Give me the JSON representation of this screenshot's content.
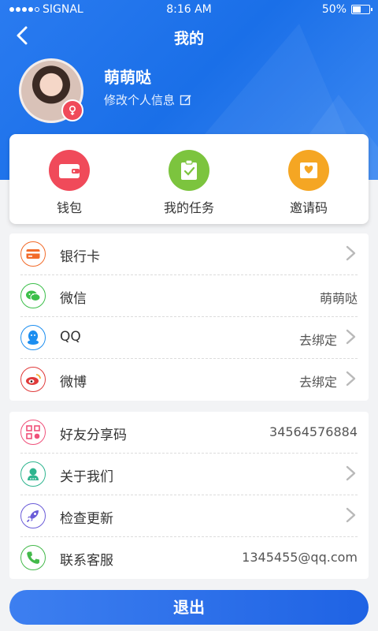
{
  "status_bar": {
    "carrier": "SIGNAL",
    "time": "8:16 AM",
    "battery": "50%",
    "battery_level": 0.5
  },
  "nav": {
    "title": "我的"
  },
  "profile": {
    "name": "萌萌哒",
    "edit_label": "修改个人信息"
  },
  "quick_actions": [
    {
      "label": "钱包",
      "icon": "wallet-icon",
      "color": "#f04a5a"
    },
    {
      "label": "我的任务",
      "icon": "task-icon",
      "color": "#7cc43e"
    },
    {
      "label": "邀请码",
      "icon": "invite-icon",
      "color": "#f5a623"
    }
  ],
  "account_rows": [
    {
      "label": "银行卡",
      "value": "",
      "icon": "bank-card-icon",
      "color": "#f26b2a",
      "arrow": true
    },
    {
      "label": "微信",
      "value": "萌萌哒",
      "icon": "wechat-icon",
      "color": "#3cbf4a",
      "arrow": false
    },
    {
      "label": "QQ",
      "value": "去绑定",
      "icon": "qq-icon",
      "color": "#1c8ef0",
      "arrow": true
    },
    {
      "label": "微博",
      "value": "去绑定",
      "icon": "weibo-icon",
      "color": "#e03b3b",
      "arrow": true
    }
  ],
  "other_rows": [
    {
      "label": "好友分享码",
      "value": "34564576884",
      "icon": "qrcode-icon",
      "color": "#f0507a",
      "arrow": false
    },
    {
      "label": "关于我们",
      "value": "",
      "icon": "about-icon",
      "color": "#2fb58f",
      "arrow": true
    },
    {
      "label": "检查更新",
      "value": "",
      "icon": "rocket-icon",
      "color": "#6a5bd8",
      "arrow": true
    },
    {
      "label": "联系客服",
      "value": "1345455@qq.com",
      "icon": "phone-icon",
      "color": "#43b94a",
      "arrow": false
    }
  ],
  "logout_label": "退出"
}
